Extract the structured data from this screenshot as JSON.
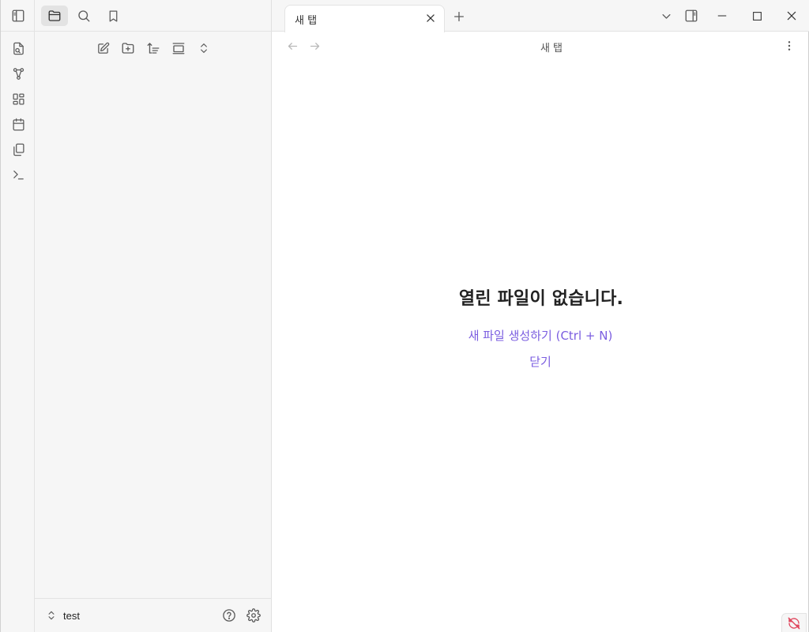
{
  "sidebar": {
    "tabs": [
      {
        "name": "files",
        "icon": "folder-icon",
        "active": true
      },
      {
        "name": "search",
        "icon": "search-icon",
        "active": false
      },
      {
        "name": "bookmarks",
        "icon": "bookmark-icon",
        "active": false
      }
    ],
    "nav_actions": [
      "new-note-icon",
      "new-folder-icon",
      "sort-icon",
      "collapse-icon",
      "expand-collapse-icon"
    ],
    "vault_name": "test"
  },
  "ribbon": {
    "items": [
      "open-quick-switcher-icon",
      "graph-view-icon",
      "canvas-icon",
      "daily-note-icon",
      "templates-icon",
      "command-palette-icon"
    ]
  },
  "tabs": [
    {
      "title": "새 탭",
      "active": true
    }
  ],
  "view": {
    "title": "새 탭",
    "empty_title": "열린 파일이 없습니다.",
    "create_action": "새 파일 생성하기 (Ctrl + N)",
    "close_action": "닫기"
  },
  "colors": {
    "accent": "#7b5ee0",
    "sidebar_bg": "#f6f6f6",
    "sync_error": "#e0425a"
  }
}
